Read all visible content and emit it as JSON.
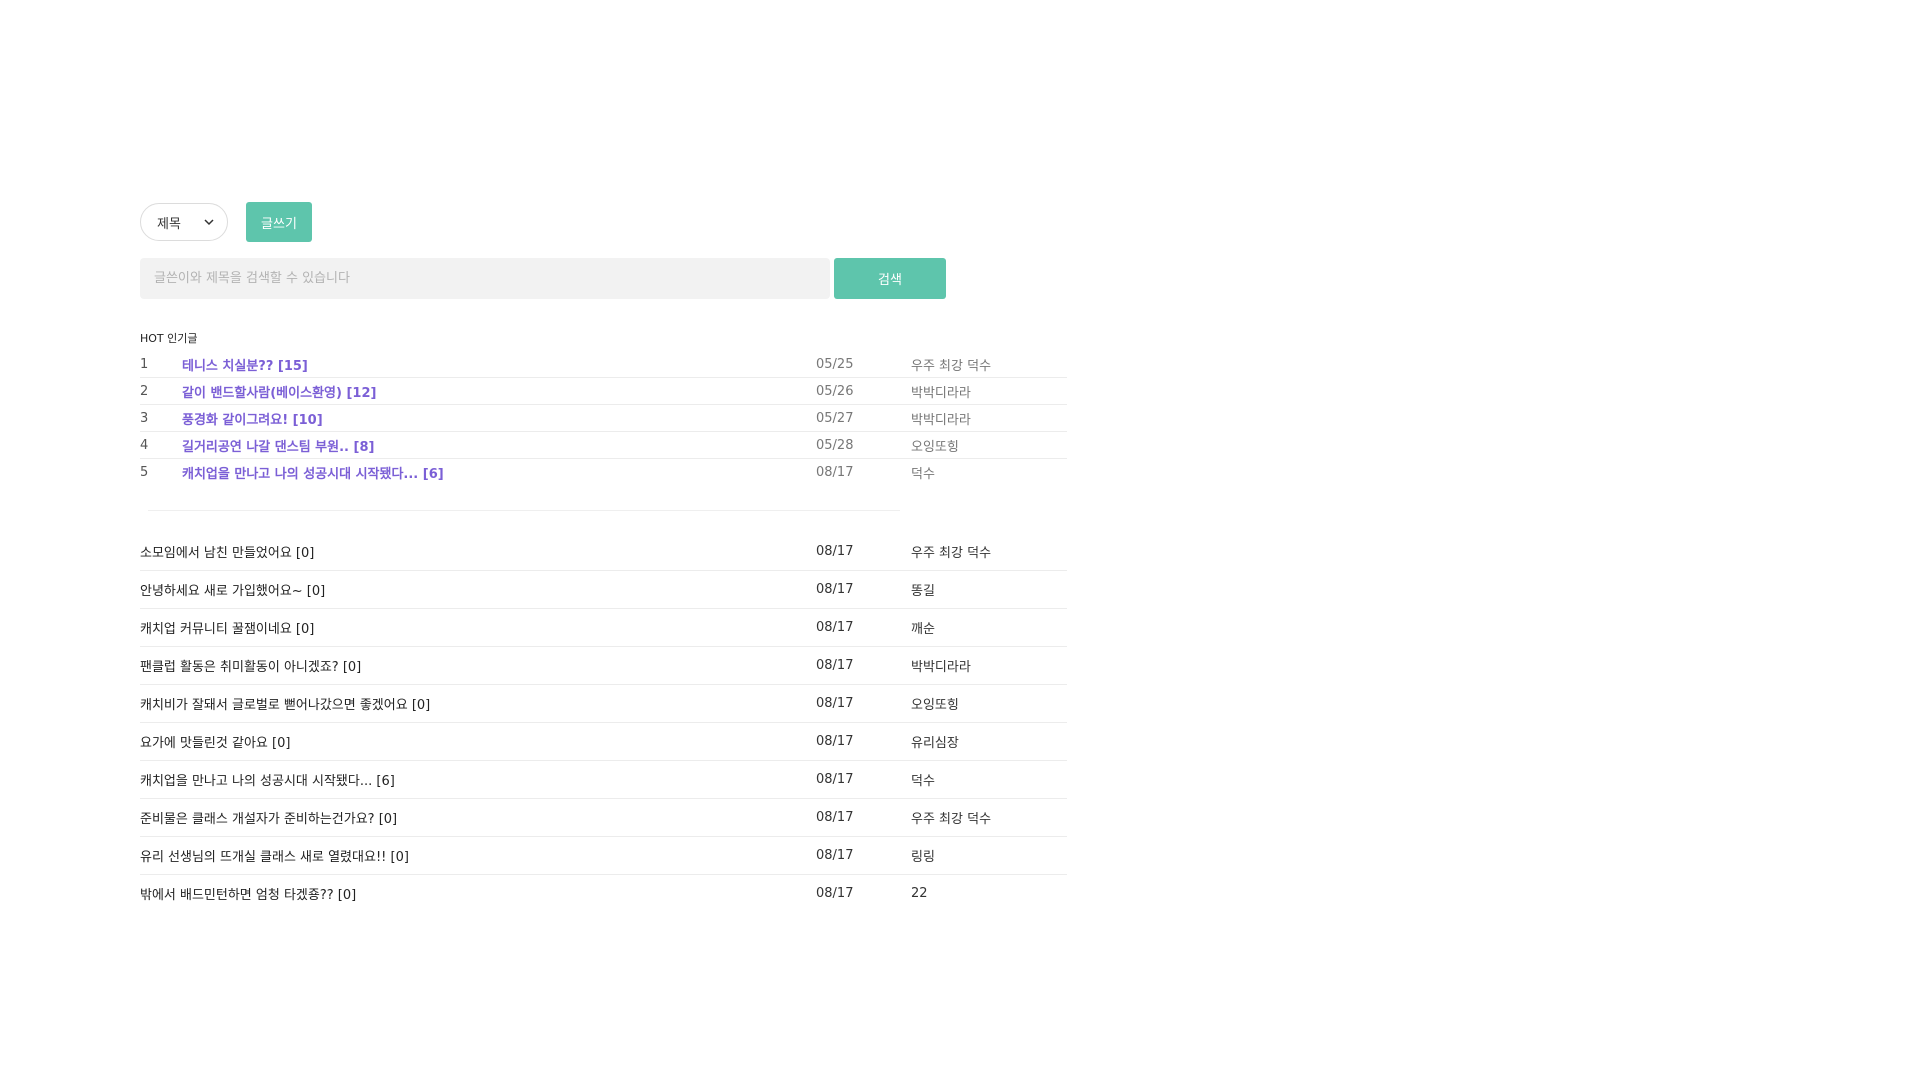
{
  "toolbar": {
    "filter_selected": "제목",
    "write_label": "글쓰기"
  },
  "search": {
    "placeholder": "글쓴이와 제목을 검색할 수 있습니다",
    "button_label": "검색"
  },
  "hot": {
    "heading": "HOT 인기글",
    "items": [
      {
        "rank": "1",
        "title": "테니스 치실분?? [15]",
        "date": "05/25",
        "author": "우주 최강 덕수"
      },
      {
        "rank": "2",
        "title": "같이 밴드할사람(베이스환영) [12]",
        "date": "05/26",
        "author": "박박디라라"
      },
      {
        "rank": "3",
        "title": "풍경화 같이그려요! [10]",
        "date": "05/27",
        "author": "박박디라라"
      },
      {
        "rank": "4",
        "title": "길거리공연 나갈 댄스팀 부원.. [8]",
        "date": "05/28",
        "author": "오잉또힝"
      },
      {
        "rank": "5",
        "title": "캐치업을 만나고 나의 성공시대 시작됐다... [6]",
        "date": "08/17",
        "author": "덕수"
      }
    ]
  },
  "posts": [
    {
      "title": "소모임에서 남친 만들었어요 [0]",
      "date": "08/17",
      "author": "우주 최강 덕수"
    },
    {
      "title": "안녕하세요 새로 가입했어요~ [0]",
      "date": "08/17",
      "author": "똥길"
    },
    {
      "title": "캐치업 커뮤니티 꿀잼이네요 [0]",
      "date": "08/17",
      "author": "깨순"
    },
    {
      "title": "팬클럽 활동은 취미활동이 아니겠죠? [0]",
      "date": "08/17",
      "author": "박박디라라"
    },
    {
      "title": "캐치비가 잘돼서 글로벌로 뻗어나갔으면 좋겠어요 [0]",
      "date": "08/17",
      "author": "오잉또힝"
    },
    {
      "title": "요가에 맛들린것 같아요 [0]",
      "date": "08/17",
      "author": "유리심장"
    },
    {
      "title": "캐치업을 만나고 나의 성공시대 시작됐다... [6]",
      "date": "08/17",
      "author": "덕수"
    },
    {
      "title": "준비물은 클래스 개설자가 준비하는건가요? [0]",
      "date": "08/17",
      "author": "우주 최강 덕수"
    },
    {
      "title": "유리 선생님의 뜨개실 클래스 새로 열렸대요!! [0]",
      "date": "08/17",
      "author": "링링"
    },
    {
      "title": "밖에서 배드민턴하면 엄청 타겠죵?? [0]",
      "date": "08/17",
      "author": "22"
    }
  ]
}
